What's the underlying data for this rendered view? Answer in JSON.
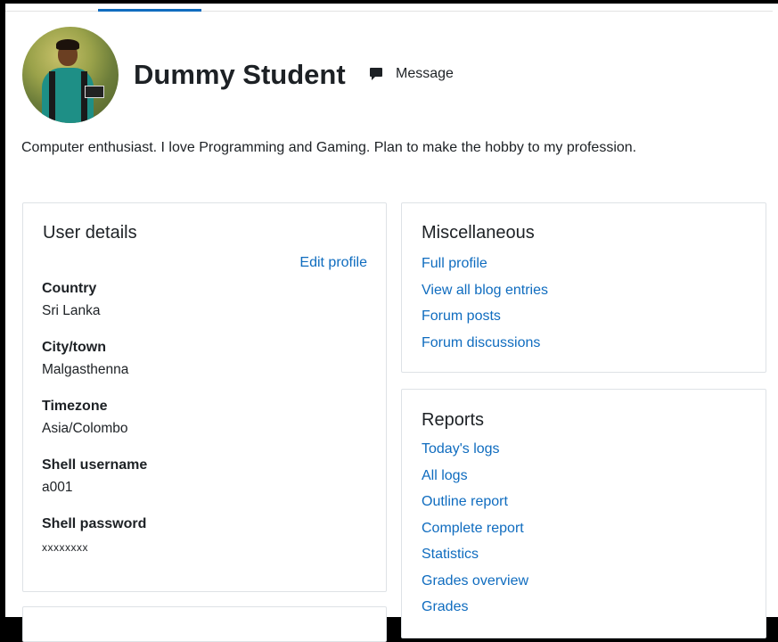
{
  "profile": {
    "name": "Dummy Student",
    "message_label": "Message",
    "bio": "Computer enthusiast. I love Programming and Gaming. Plan to make the hobby to my profession."
  },
  "user_details": {
    "title": "User details",
    "edit_profile": "Edit profile",
    "fields": [
      {
        "label": "Country",
        "value": "Sri Lanka"
      },
      {
        "label": "City/town",
        "value": "Malgasthenna"
      },
      {
        "label": "Timezone",
        "value": "Asia/Colombo"
      },
      {
        "label": "Shell username",
        "value": "a001"
      },
      {
        "label": "Shell password",
        "value": "xxxxxxxx"
      }
    ]
  },
  "miscellaneous": {
    "title": "Miscellaneous",
    "links": [
      "Full profile",
      "View all blog entries",
      "Forum posts",
      "Forum discussions"
    ]
  },
  "reports": {
    "title": "Reports",
    "links": [
      "Today's logs",
      "All logs",
      "Outline report",
      "Complete report",
      "Statistics",
      "Grades overview",
      "Grades"
    ]
  },
  "icons": {
    "message": "message-icon"
  },
  "colors": {
    "link": "#0f6cbf",
    "text": "#1d2125",
    "border": "#dee2e6",
    "active_tab": "#0f6cbf"
  }
}
